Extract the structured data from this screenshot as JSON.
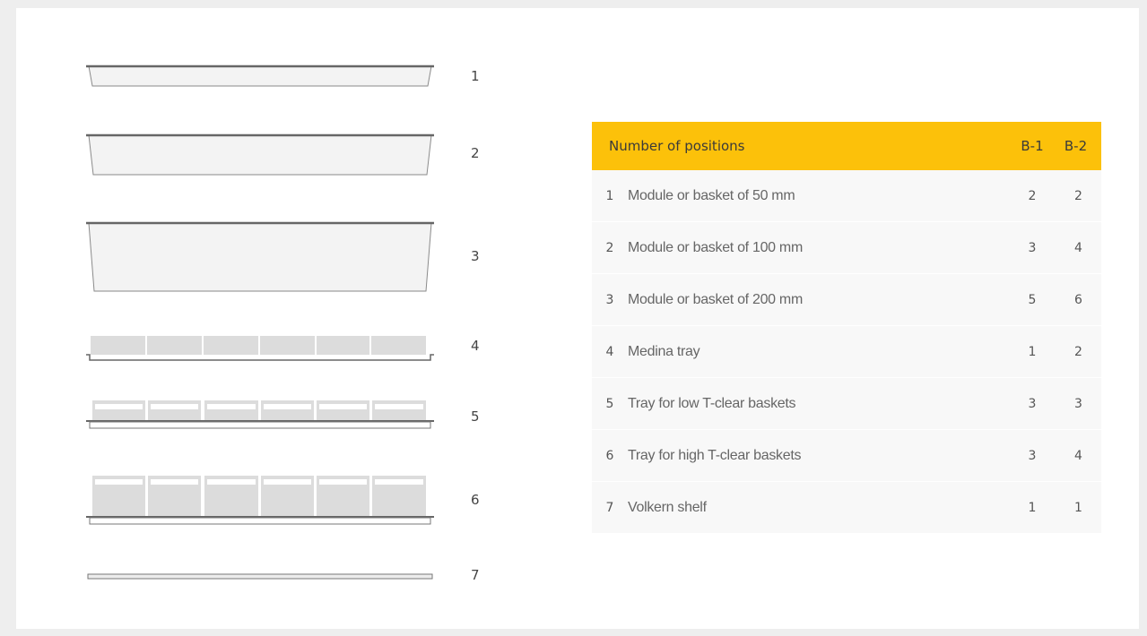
{
  "items": [
    {
      "number": "1"
    },
    {
      "number": "2"
    },
    {
      "number": "3"
    },
    {
      "number": "4"
    },
    {
      "number": "5"
    },
    {
      "number": "6"
    },
    {
      "number": "7"
    }
  ],
  "table": {
    "header": {
      "label": "Number of positions",
      "col1": "B-1",
      "col2": "B-2"
    },
    "rows": [
      {
        "num": "1",
        "label": "Module or basket of 50 mm",
        "b1": "2",
        "b2": "2"
      },
      {
        "num": "2",
        "label": "Module or basket of 100 mm",
        "b1": "3",
        "b2": "4"
      },
      {
        "num": "3",
        "label": "Module or basket of 200 mm",
        "b1": "5",
        "b2": "6"
      },
      {
        "num": "4",
        "label": "Medina tray",
        "b1": "1",
        "b2": "2"
      },
      {
        "num": "5",
        "label": "Tray for low T-clear baskets",
        "b1": "3",
        "b2": "3"
      },
      {
        "num": "6",
        "label": "Tray for high T-clear baskets",
        "b1": "3",
        "b2": "4"
      },
      {
        "num": "7",
        "label": "Volkern shelf",
        "b1": "1",
        "b2": "1"
      }
    ]
  },
  "colors": {
    "accent": "#fcc10a",
    "row_bg": "#f8f8f8",
    "module_fill": "#f2f2f2",
    "tray_fill": "#dcdcdc",
    "outline": "#777777"
  }
}
